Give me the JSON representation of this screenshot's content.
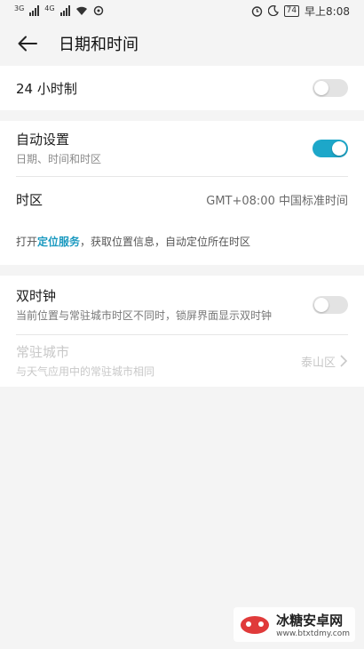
{
  "status_bar": {
    "left_net1": "3G",
    "left_net2": "4G",
    "battery": "74",
    "time": "早上8:08"
  },
  "header": {
    "title": "日期和时间"
  },
  "items": {
    "hour24": {
      "label": "24 小时制",
      "enabled": false
    },
    "auto": {
      "label": "自动设置",
      "sub": "日期、时间和时区",
      "enabled": true
    },
    "timezone": {
      "label": "时区",
      "value": "GMT+08:00 中国标准时间"
    },
    "hint": {
      "prefix": "打开",
      "link": "定位服务",
      "suffix": "，获取位置信息，自动定位所在时区"
    },
    "dual": {
      "label": "双时钟",
      "sub": "当前位置与常驻城市时区不同时，锁屏界面显示双时钟",
      "enabled": false
    },
    "resident": {
      "label": "常驻城市",
      "sub": "与天气应用中的常驻城市相同",
      "value": "泰山区"
    }
  },
  "watermark": {
    "title": "冰糖安卓网",
    "url": "www.btxtdmy.com"
  },
  "colors": {
    "accent": "#1da7c9",
    "link": "#1c9ac0"
  }
}
